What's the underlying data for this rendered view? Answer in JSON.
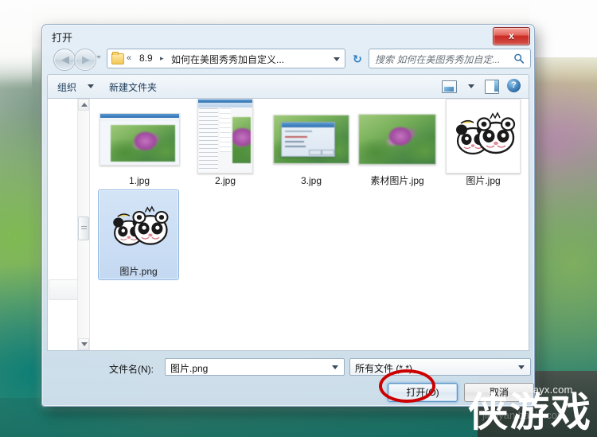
{
  "window": {
    "title": "打开",
    "close_label": "x"
  },
  "navigation": {
    "back_icon": "back-arrow-icon",
    "forward_icon": "forward-arrow-icon",
    "history_icon": "chevron-down-icon",
    "address": {
      "overflow_chevron": "«",
      "crumb1": "8.9",
      "separator": "▸",
      "crumb2": "如何在美图秀秀加自定义...",
      "dropdown_icon": "chevron-down-icon",
      "folder_icon": "folder-icon"
    },
    "refresh_icon": "refresh-icon",
    "refresh_glyph": "↻",
    "search": {
      "placeholder": "搜索 如何在美图秀秀加自定...",
      "icon": "search-icon"
    }
  },
  "toolbar": {
    "organize_label": "组织",
    "organize_caret_icon": "chevron-down-icon",
    "new_folder_label": "新建文件夹",
    "view_icon": "view-layout-icon",
    "view_caret_icon": "chevron-down-icon",
    "preview_pane_icon": "preview-pane-icon",
    "help_icon": "help-icon",
    "help_glyph": "?"
  },
  "nav_pane": {
    "scrollbar_up_icon": "scroll-up-arrow-icon",
    "scrollbar_down_icon": "scroll-down-arrow-icon",
    "scrollbar_thumb": "scroll-thumb"
  },
  "files": [
    {
      "name": "1.jpg",
      "type": "screenshot-flower",
      "selected": false
    },
    {
      "name": "2.jpg",
      "type": "screenshot-editor",
      "selected": false
    },
    {
      "name": "3.jpg",
      "type": "screenshot-dialog",
      "selected": false
    },
    {
      "name": "素材图片.jpg",
      "type": "photo-flower",
      "selected": false
    },
    {
      "name": "图片.jpg",
      "type": "panda",
      "selected": false
    },
    {
      "name": "图片.png",
      "type": "panda",
      "selected": true
    }
  ],
  "bottom": {
    "filename_label": "文件名(N):",
    "filename_value": "图片.png",
    "filename_caret_icon": "chevron-down-icon",
    "filter_value": "所有文件 (*.*)",
    "filter_caret_icon": "chevron-down-icon",
    "open_label": "打开(O)",
    "cancel_label": "取消"
  },
  "annotation": {
    "shape": "red-ellipse-highlight",
    "color": "#cc0000",
    "target": "打开(O)"
  },
  "watermark": {
    "site": "xiayx.com",
    "brand": "侠游戏",
    "faint": "jingyan.baidu.com"
  },
  "colors": {
    "accent": "#2f6fae",
    "close_button": "#c92a23",
    "selection": "#c4d9f2",
    "annotation": "#cc0000"
  }
}
